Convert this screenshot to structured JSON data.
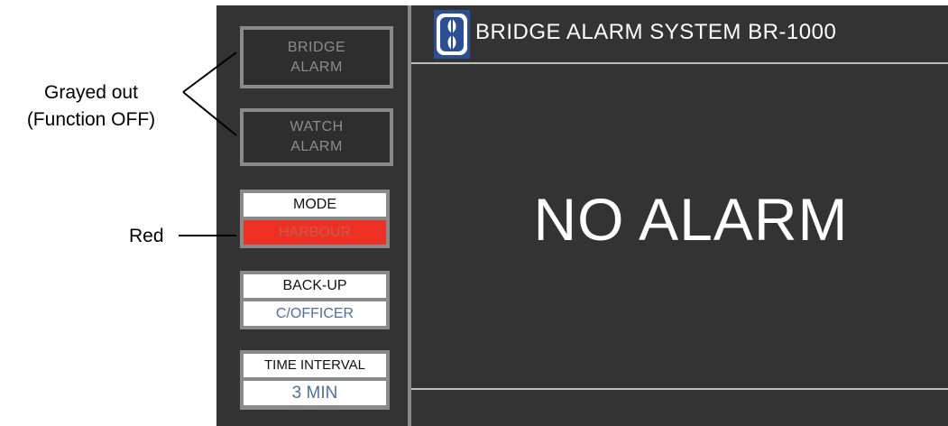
{
  "window": {
    "title": "BRIDGE ALARM SYSTEM BR-1000",
    "logo_icon": "propeller-logo-icon"
  },
  "buttons": {
    "bridge_alarm": {
      "line1": "BRIDGE",
      "line2": "ALARM",
      "state": "grayed out"
    },
    "watch_alarm": {
      "line1": "WATCH",
      "line2": "ALARM",
      "state": "grayed out"
    }
  },
  "fields": {
    "mode": {
      "label": "MODE",
      "value": "HARBOUR",
      "value_bg": "#ee3024"
    },
    "backup": {
      "label": "BACK-UP",
      "value": "C/OFFICER"
    },
    "time_interval": {
      "label": "TIME INTERVAL",
      "value": "3 MIN"
    }
  },
  "status": {
    "text": "NO ALARM"
  },
  "annotations": {
    "grayed_line1": "Grayed out",
    "grayed_line2": "(Function OFF)",
    "red": "Red"
  },
  "colors": {
    "panel_bg": "#333333",
    "accent_blue": "#2b4f94",
    "value_text": "#4f6fa6",
    "alert_red": "#ee3024"
  }
}
